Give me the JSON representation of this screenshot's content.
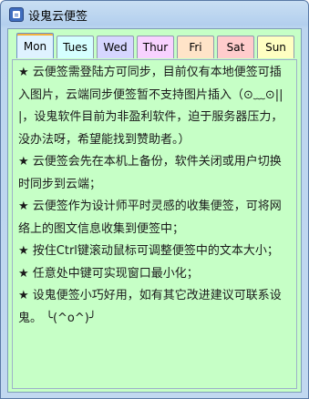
{
  "window": {
    "title": "设鬼云便签",
    "icon": "note-app-icon"
  },
  "tabs": [
    {
      "label": "Mon",
      "color": "#dff2ff",
      "active": true
    },
    {
      "label": "Tues",
      "color": "#d5ffff",
      "active": false
    },
    {
      "label": "Wed",
      "color": "#d6d6ff",
      "active": false
    },
    {
      "label": "Thur",
      "color": "#f8d2ff",
      "active": false
    },
    {
      "label": "Fri",
      "color": "#ffe4c8",
      "active": false
    },
    {
      "label": "Sat",
      "color": "#ffcccc",
      "active": false
    },
    {
      "label": "Sun",
      "color": "#ffffc2",
      "active": false
    }
  ],
  "note": {
    "background": "#c6ffc6",
    "paragraphs": [
      "★ 云便签需登陆方可同步，目前仅有本地便签可插入图片，云端同步便签暂不支持图片插入（⊙﹏⊙|||，设鬼软件目前为非盈利软件，迫于服务器压力，没办法呀，希望能找到赞助者。）",
      "★ 云便签会先在本机上备份，软件关闭或用户切换时同步到云端；",
      "★ 云便签作为设计师平时灵感的收集便签，可将网络上的图文信息收集到便签中；",
      "★ 按住Ctrl键滚动鼠标可调整便签中的文本大小；",
      "★ 任意处中键可实现窗口最小化；",
      "★ 设鬼便签小巧好用，如有其它改进建议可联系设鬼。 ╰(^o^)╯"
    ]
  }
}
